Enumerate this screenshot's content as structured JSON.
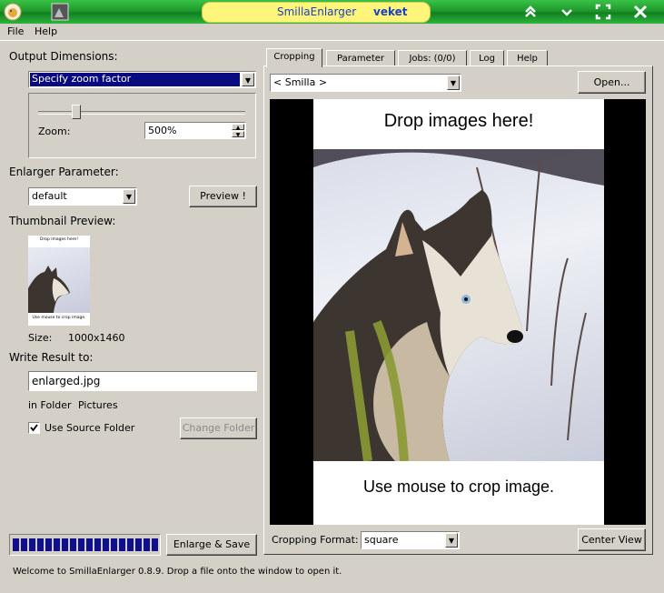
{
  "window": {
    "app_title": "SmillaEnlarger",
    "user": "veket"
  },
  "menu": [
    "File",
    "Help"
  ],
  "left": {
    "output_dimensions_label": "Output Dimensions:",
    "dimension_mode": "Specify zoom factor",
    "zoom_label": "Zoom:",
    "zoom_value": "500%",
    "zoom_slider_fraction": 0.17,
    "enlarger_parameter_label": "Enlarger Parameter:",
    "parameter_preset": "default",
    "preview_button": "Preview !",
    "thumbnail_label": "Thumbnail Preview:",
    "thumbnail_caption_top": "Drop images here!",
    "thumbnail_caption_bottom": "Use mouse to crop image.",
    "size_label": "Size:",
    "size_value": "1000x1460",
    "write_result_label": "Write Result to:",
    "output_filename": "enlarged.jpg",
    "in_folder_label": "in Folder",
    "folder_name": "Pictures",
    "use_source_folder_label": "Use Source Folder",
    "use_source_folder_checked": true,
    "change_folder_button": "Change Folder",
    "progress_fraction": 1.0,
    "enlarge_save_button": "Enlarge & Save"
  },
  "tabs": [
    "Cropping",
    "Parameter",
    "Jobs: (0/0)",
    "Log",
    "Help"
  ],
  "active_tab": "Cropping",
  "cropping": {
    "source_select": "< Smilla >",
    "open_button": "Open...",
    "drop_text": "Drop images here!",
    "crop_hint": "Use mouse to crop image.",
    "cropping_format_label": "Cropping Format:",
    "cropping_format": "square",
    "center_view_button": "Center View"
  },
  "status_text": "Welcome to SmillaEnlarger 0.8.9.  Drop a file onto the window to open it.",
  "colors": {
    "titlebar_green": "#1f9a2c",
    "title_pill": "#fff57a",
    "selection_blue": "#0a0a80",
    "progress_blue": "#10108c"
  }
}
